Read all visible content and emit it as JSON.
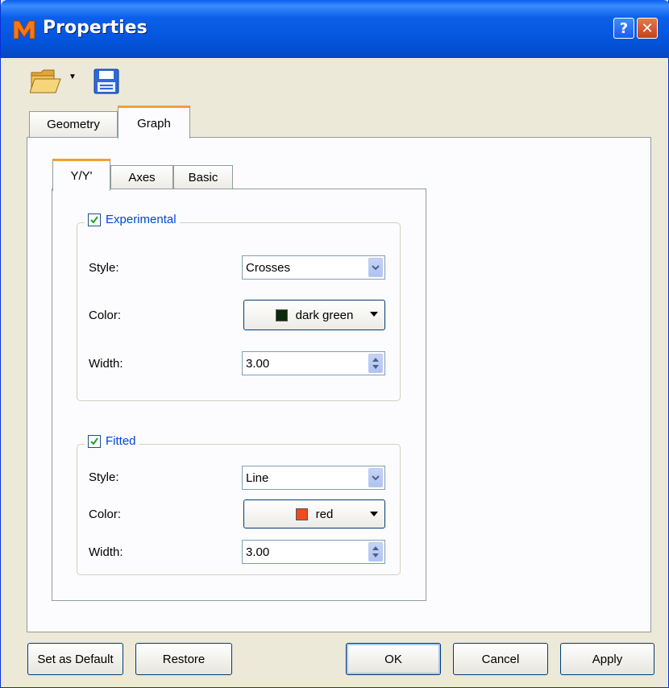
{
  "window": {
    "title": "Properties",
    "help_label": "?",
    "close_label": "✕"
  },
  "toolbar": {
    "open_icon": "folder-open-icon",
    "save_icon": "floppy-disk-icon"
  },
  "outer_tabs": [
    {
      "label": "Geometry",
      "active": false
    },
    {
      "label": "Graph",
      "active": true
    }
  ],
  "inner_tabs": [
    {
      "label": "Y/Y'",
      "active": true
    },
    {
      "label": "Axes",
      "active": false
    },
    {
      "label": "Basic",
      "active": false
    }
  ],
  "experimental": {
    "label": "Experimental",
    "checked": true,
    "style_label": "Style:",
    "style_value": "Crosses",
    "color_label": "Color:",
    "color_value": "dark green",
    "color_swatch": "#0b2a0b",
    "width_label": "Width:",
    "width_value": "3.00"
  },
  "fitted": {
    "label": "Fitted",
    "checked": true,
    "style_label": "Style:",
    "style_value": "Line",
    "color_label": "Color:",
    "color_value": "red",
    "color_swatch": "#f04a1e",
    "width_label": "Width:",
    "width_value": "3.00"
  },
  "buttons": {
    "set_default": "Set as Default",
    "restore": "Restore",
    "ok": "OK",
    "cancel": "Cancel",
    "apply": "Apply"
  }
}
